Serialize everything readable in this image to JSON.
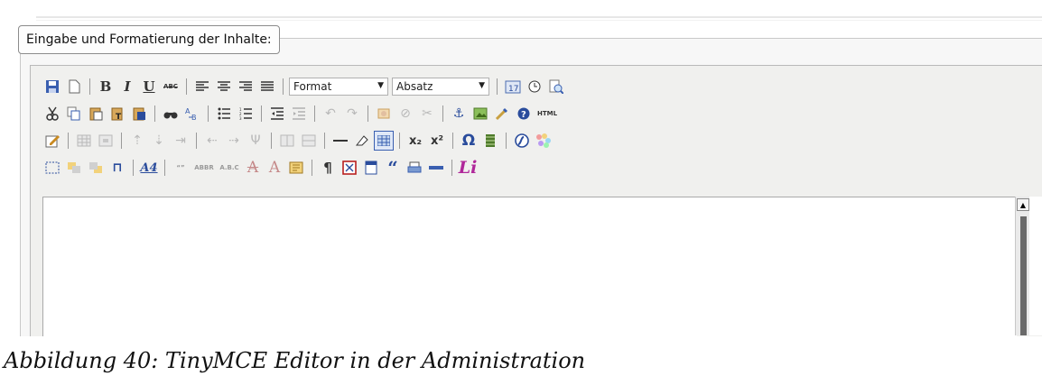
{
  "legend": "Eingabe und Formatierung der Inhalte:",
  "caption": "Abbildung 40: TinyMCE Editor in der Administration",
  "toolbar": {
    "format_select": "Format",
    "block_select": "Absatz",
    "bold_label": "B",
    "italic_label": "I",
    "underline_label": "U",
    "strike_label": "ABC",
    "html_label": "HTML",
    "subscript_label": "x₂",
    "superscript_label": "x²",
    "omega_label": "Ω",
    "pilcrow_label": "¶",
    "quote_label": "“",
    "li_label": "Li",
    "cite_label": "“”",
    "abbr_label": "ABBR",
    "acronym_label": "A.B.C",
    "A_label": "A",
    "A_plain_label": "A",
    "insdate_label": "17"
  },
  "icons": {
    "row1": [
      "save-icon",
      "newdoc-icon",
      "bold-icon",
      "italic-icon",
      "underline-icon",
      "strikethrough-icon",
      "align-left-icon",
      "align-center-icon",
      "align-right-icon",
      "align-justify-icon",
      "format-select",
      "block-select",
      "insert-date-icon",
      "insert-time-icon",
      "preview-icon"
    ],
    "row2": [
      "cut-icon",
      "copy-icon",
      "paste-icon",
      "paste-text-icon",
      "paste-word-icon",
      "search-icon",
      "replace-icon",
      "bullet-list-icon",
      "numbered-list-icon",
      "outdent-icon",
      "indent-icon",
      "undo-icon",
      "redo-icon",
      "link-icon",
      "unlink-icon",
      "cleanup-icon",
      "anchor-icon",
      "image-icon",
      "code-icon",
      "help-icon",
      "html-icon"
    ],
    "row3": [
      "edit-icon",
      "table-props-icon",
      "cell-props-icon",
      "row-before-icon",
      "row-after-icon",
      "delete-row-icon",
      "col-before-icon",
      "col-after-icon",
      "delete-col-icon",
      "split-cells-icon",
      "merge-cells-icon",
      "hr-icon",
      "remove-format-icon",
      "visual-aid-icon",
      "subscript-icon",
      "superscript-icon",
      "charmap-icon",
      "media-icon",
      "flash-icon",
      "emotions-icon"
    ],
    "row4": [
      "select-box-icon",
      "layer-forward-icon",
      "layer-backward-icon",
      "absolute-icon",
      "styleprops-icon",
      "cite-icon",
      "abbr-icon",
      "acronym-icon",
      "del-icon",
      "ins-icon",
      "attribs-icon",
      "visualchars-icon",
      "nonbreaking-icon",
      "template-icon",
      "blockquote-icon",
      "print-icon",
      "pagebreak-icon",
      "li-icon"
    ]
  },
  "colors": {
    "toolbar_bg": "#f0f0ee",
    "accent_blue": "#2a4c9c"
  }
}
